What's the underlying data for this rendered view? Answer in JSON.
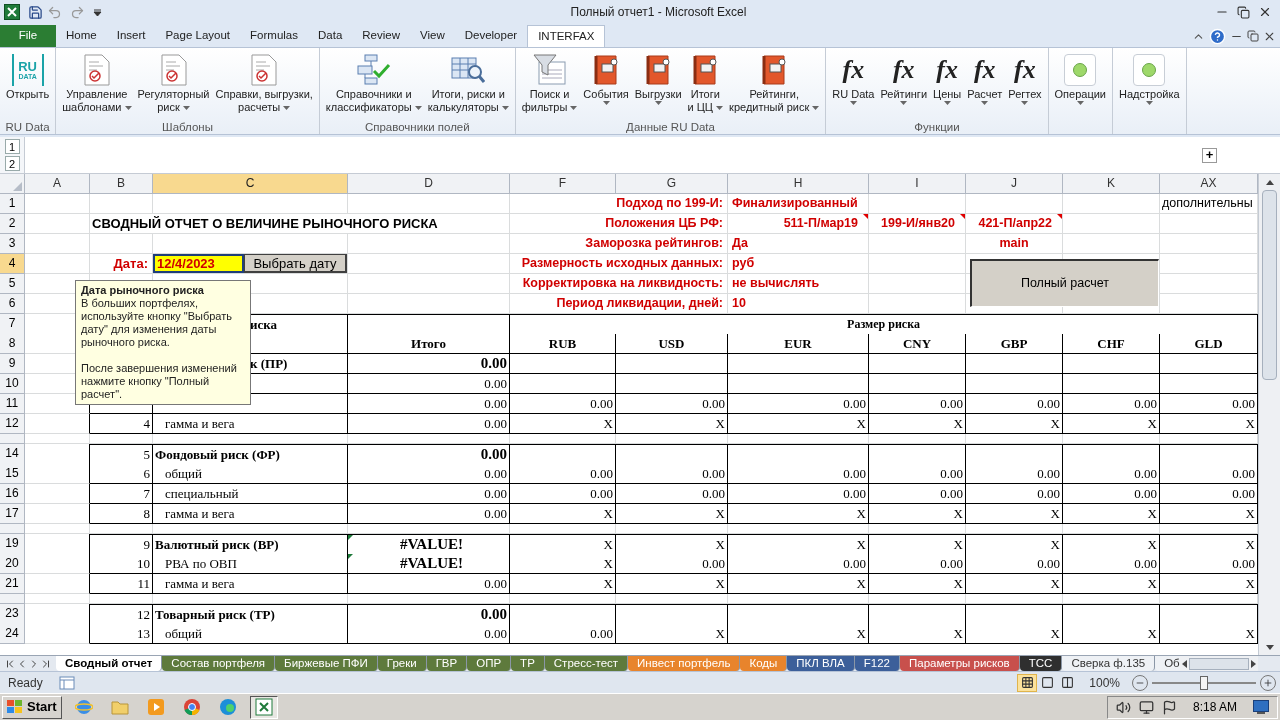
{
  "window": {
    "title": "Полный отчет1 - Microsoft Excel"
  },
  "ribbon_tabs": [
    {
      "label": "File",
      "kind": "file",
      "selected": false
    },
    {
      "label": "Home",
      "kind": "tab",
      "selected": false
    },
    {
      "label": "Insert",
      "kind": "tab",
      "selected": false
    },
    {
      "label": "Page Layout",
      "kind": "tab",
      "selected": false
    },
    {
      "label": "Formulas",
      "kind": "tab",
      "selected": false
    },
    {
      "label": "Data",
      "kind": "tab",
      "selected": false
    },
    {
      "label": "Review",
      "kind": "tab",
      "selected": false
    },
    {
      "label": "View",
      "kind": "tab",
      "selected": false
    },
    {
      "label": "Developer",
      "kind": "tab",
      "selected": false
    },
    {
      "label": "INTERFAX",
      "kind": "tab",
      "selected": true
    }
  ],
  "ribbon_groups": [
    {
      "label": "RU Data",
      "buttons": [
        {
          "kind": "ru",
          "glyph": [
            "RU",
            "DATA"
          ],
          "lines": [
            "Открыть"
          ],
          "dropdown": false
        }
      ]
    },
    {
      "label": "Шаблоны",
      "buttons": [
        {
          "kind": "doc",
          "lines": [
            "Управление",
            "шаблонами"
          ],
          "dropdown": true
        },
        {
          "kind": "doc",
          "lines": [
            "Регуляторный",
            "риск"
          ],
          "dropdown": true
        },
        {
          "kind": "doc",
          "lines": [
            "Справки, выгрузки,",
            "расчеты"
          ],
          "dropdown": true
        }
      ]
    },
    {
      "label": "Справочники полей",
      "buttons": [
        {
          "kind": "flow",
          "lines": [
            "Справочники и",
            "классификаторы"
          ],
          "dropdown": true
        },
        {
          "kind": "table",
          "lines": [
            "Итоги, риски и",
            "калькуляторы"
          ],
          "dropdown": true
        }
      ]
    },
    {
      "label": "Данные RU Data",
      "buttons": [
        {
          "kind": "funnel",
          "lines": [
            "Поиск и",
            "фильтры"
          ],
          "dropdown": true
        },
        {
          "kind": "book",
          "lines": [
            "События"
          ],
          "dropdown": true
        },
        {
          "kind": "book",
          "lines": [
            "Выгрузки"
          ],
          "dropdown": true
        },
        {
          "kind": "book",
          "lines": [
            "Итоги",
            "и ЦЦ"
          ],
          "dropdown": true
        },
        {
          "kind": "book",
          "lines": [
            "Рейтинги,",
            "кредитный риск"
          ],
          "dropdown": true
        }
      ]
    },
    {
      "label": "Функции",
      "buttons": [
        {
          "kind": "fx",
          "glyph": [
            "fx"
          ],
          "lines": [
            "RU Data"
          ],
          "dropdown": true
        },
        {
          "kind": "fx",
          "glyph": [
            "fx"
          ],
          "lines": [
            "Рейтинги"
          ],
          "dropdown": true
        },
        {
          "kind": "fx",
          "glyph": [
            "fx"
          ],
          "lines": [
            "Цены"
          ],
          "dropdown": true
        },
        {
          "kind": "fx",
          "glyph": [
            "fx"
          ],
          "lines": [
            "Расчет"
          ],
          "dropdown": true
        },
        {
          "kind": "fx",
          "glyph": [
            "fx"
          ],
          "lines": [
            "Регтех"
          ],
          "dropdown": true
        }
      ]
    },
    {
      "buttons": [
        {
          "kind": "light",
          "lines": [
            "Операции"
          ],
          "dropdown": true
        }
      ]
    },
    {
      "buttons": [
        {
          "kind": "light",
          "lines": [
            "Надстройка"
          ],
          "dropdown": true
        }
      ]
    }
  ],
  "sheet": {
    "outline_levels": [
      "1",
      "2"
    ],
    "expand_button": "+",
    "columns": [
      {
        "label": "A",
        "selected": false
      },
      {
        "label": "B",
        "selected": false
      },
      {
        "label": "C",
        "selected": true
      },
      {
        "label": "D",
        "selected": false
      },
      {
        "label": "F",
        "selected": false
      },
      {
        "label": "G",
        "selected": false
      },
      {
        "label": "H",
        "selected": false
      },
      {
        "label": "I",
        "selected": false
      },
      {
        "label": "J",
        "selected": false
      },
      {
        "label": "K",
        "selected": false
      },
      {
        "label": "AX",
        "selected": false
      }
    ],
    "rows": [
      {
        "kind": "row",
        "header": "1",
        "selected": false,
        "bordered": false,
        "cells": [
          null,
          null,
          null,
          null,
          {
            "kind": "label",
            "text": "Подход по 199-И:"
          },
          {
            "kind": "value",
            "text": "Финализированный"
          },
          null,
          null,
          null,
          {
            "kind": "note",
            "text": "дополнительны"
          }
        ]
      },
      {
        "kind": "row",
        "header": "2",
        "selected": false,
        "bordered": false,
        "cells": [
          null,
          {
            "kind": "title",
            "text": "СВОДНЫЙ ОТЧЕТ О ВЕЛИЧИНЕ РЫНОЧНОГО РИСКА"
          },
          {
            "kind": "label",
            "text": "Положения ЦБ РФ:"
          },
          {
            "kind": "ref",
            "text": "511-П/мар19"
          },
          {
            "kind": "ref",
            "text": "199-И/янв20"
          },
          {
            "kind": "ref",
            "text": "421-П/апр22"
          },
          null,
          null
        ]
      },
      {
        "kind": "row",
        "header": "3",
        "selected": false,
        "bordered": false,
        "cells": [
          null,
          null,
          null,
          null,
          {
            "kind": "label",
            "text": "Заморозка рейтингов:"
          },
          {
            "kind": "value",
            "text": "Да"
          },
          null,
          {
            "kind": "center",
            "text": "main"
          },
          null,
          null
        ]
      },
      {
        "kind": "row",
        "header": "4",
        "selected": true,
        "bordered": false,
        "cells": [
          null,
          {
            "kind": "caption",
            "text": "Дата:"
          },
          {
            "kind": "date",
            "text": "12/4/2023",
            "button": "Выбрать дату"
          },
          null,
          {
            "kind": "label",
            "text": "Размерность исходных данных:"
          },
          {
            "kind": "value",
            "text": "руб"
          },
          null,
          null,
          null,
          null
        ]
      },
      {
        "kind": "row",
        "header": "5",
        "selected": false,
        "bordered": false,
        "cells": [
          null,
          null,
          null,
          null,
          {
            "kind": "label",
            "text": "Корректировка на ликвидность:"
          },
          {
            "kind": "value",
            "text": "не вычислять"
          },
          null,
          null,
          null,
          null
        ]
      },
      {
        "kind": "row",
        "header": "6",
        "selected": false,
        "bordered": false,
        "cells": [
          null,
          null,
          null,
          null,
          {
            "kind": "label",
            "text": "Период ликвидации, дней:"
          },
          {
            "kind": "value",
            "text": "10"
          },
          null,
          null,
          null,
          null
        ]
      },
      {
        "kind": "row",
        "header": "7",
        "selected": false,
        "bordered": true,
        "cells": [
          null,
          null,
          {
            "kind": "covered",
            "text": "иска"
          },
          null,
          {
            "kind": "wide",
            "text": "Размер риска"
          }
        ]
      },
      {
        "kind": "row",
        "header": "8",
        "selected": false,
        "bordered": true,
        "cells": [
          null,
          null,
          null,
          {
            "kind": "head",
            "text": "Итого"
          },
          {
            "kind": "head",
            "text": "RUB"
          },
          {
            "kind": "head",
            "text": "USD"
          },
          {
            "kind": "head",
            "text": "EUR"
          },
          {
            "kind": "head",
            "text": "CNY"
          },
          {
            "kind": "head",
            "text": "GBP"
          },
          {
            "kind": "head",
            "text": "CHF"
          },
          {
            "kind": "head",
            "text": "GLD"
          }
        ]
      },
      {
        "kind": "row",
        "header": "9",
        "selected": false,
        "bordered": true,
        "cells": [
          null,
          null,
          {
            "kind": "covered",
            "text": "к (ПР)"
          },
          {
            "kind": "total",
            "text": "0.00"
          },
          null,
          null,
          null,
          null,
          null,
          null,
          null
        ]
      },
      {
        "kind": "row",
        "header": "10",
        "selected": false,
        "bordered": true,
        "cells": [
          null,
          null,
          null,
          {
            "kind": "num",
            "text": "0.00"
          },
          null,
          null,
          null,
          null,
          null,
          null,
          null
        ]
      },
      {
        "kind": "row",
        "header": "11",
        "selected": false,
        "bordered": true,
        "cells": [
          null,
          null,
          null,
          {
            "kind": "num",
            "text": "0.00"
          },
          {
            "kind": "num",
            "text": "0.00"
          },
          {
            "kind": "num",
            "text": "0.00"
          },
          {
            "kind": "num",
            "text": "0.00"
          },
          {
            "kind": "num",
            "text": "0.00"
          },
          {
            "kind": "num",
            "text": "0.00"
          },
          {
            "kind": "num",
            "text": "0.00"
          },
          {
            "kind": "num",
            "text": "0.00"
          }
        ]
      },
      {
        "kind": "row",
        "header": "12",
        "selected": false,
        "bordered": true,
        "cells": [
          null,
          {
            "kind": "index",
            "text": "4"
          },
          {
            "kind": "name",
            "text": "гамма и вега"
          },
          {
            "kind": "num",
            "text": "0.00"
          },
          {
            "kind": "num",
            "text": "X"
          },
          {
            "kind": "num",
            "text": "X"
          },
          {
            "kind": "num",
            "text": "X"
          },
          {
            "kind": "num",
            "text": "X"
          },
          {
            "kind": "num",
            "text": "X"
          },
          {
            "kind": "num",
            "text": "X"
          },
          {
            "kind": "num",
            "text": "X"
          }
        ]
      },
      {
        "kind": "spacer"
      },
      {
        "kind": "row",
        "header": "14",
        "selected": false,
        "bordered": true,
        "cells": [
          null,
          {
            "kind": "index",
            "text": "5"
          },
          {
            "kind": "group",
            "text": "Фондовый риск (ФР)"
          },
          {
            "kind": "total",
            "text": "0.00"
          },
          null,
          null,
          null,
          null,
          null,
          null,
          null
        ]
      },
      {
        "kind": "row",
        "header": "15",
        "selected": false,
        "bordered": true,
        "cells": [
          null,
          {
            "kind": "index",
            "text": "6"
          },
          {
            "kind": "name",
            "text": "общий"
          },
          {
            "kind": "num",
            "text": "0.00"
          },
          {
            "kind": "num",
            "text": "0.00"
          },
          {
            "kind": "num",
            "text": "0.00"
          },
          {
            "kind": "num",
            "text": "0.00"
          },
          {
            "kind": "num",
            "text": "0.00"
          },
          {
            "kind": "num",
            "text": "0.00"
          },
          {
            "kind": "num",
            "text": "0.00"
          },
          {
            "kind": "num",
            "text": "0.00"
          }
        ]
      },
      {
        "kind": "row",
        "header": "16",
        "selected": false,
        "bordered": true,
        "cells": [
          null,
          {
            "kind": "index",
            "text": "7"
          },
          {
            "kind": "name",
            "text": "специальный"
          },
          {
            "kind": "num",
            "text": "0.00"
          },
          {
            "kind": "num",
            "text": "0.00"
          },
          {
            "kind": "num",
            "text": "0.00"
          },
          {
            "kind": "num",
            "text": "0.00"
          },
          {
            "kind": "num",
            "text": "0.00"
          },
          {
            "kind": "num",
            "text": "0.00"
          },
          {
            "kind": "num",
            "text": "0.00"
          },
          {
            "kind": "num",
            "text": "0.00"
          }
        ]
      },
      {
        "kind": "row",
        "header": "17",
        "selected": false,
        "bordered": true,
        "cells": [
          null,
          {
            "kind": "index",
            "text": "8"
          },
          {
            "kind": "name",
            "text": "гамма и вега"
          },
          {
            "kind": "num",
            "text": "0.00"
          },
          {
            "kind": "num",
            "text": "X"
          },
          {
            "kind": "num",
            "text": "X"
          },
          {
            "kind": "num",
            "text": "X"
          },
          {
            "kind": "num",
            "text": "X"
          },
          {
            "kind": "num",
            "text": "X"
          },
          {
            "kind": "num",
            "text": "X"
          },
          {
            "kind": "num",
            "text": "X"
          }
        ]
      },
      {
        "kind": "spacer"
      },
      {
        "kind": "row",
        "header": "19",
        "selected": false,
        "bordered": true,
        "cells": [
          null,
          {
            "kind": "index",
            "text": "9"
          },
          {
            "kind": "group",
            "text": "Валютный риск (ВР)"
          },
          {
            "kind": "error",
            "text": "#VALUE!"
          },
          {
            "kind": "num",
            "text": "X"
          },
          {
            "kind": "num",
            "text": "X"
          },
          {
            "kind": "num",
            "text": "X"
          },
          {
            "kind": "num",
            "text": "X"
          },
          {
            "kind": "num",
            "text": "X"
          },
          {
            "kind": "num",
            "text": "X"
          },
          {
            "kind": "num",
            "text": "X"
          }
        ]
      },
      {
        "kind": "row",
        "header": "20",
        "selected": false,
        "bordered": true,
        "cells": [
          null,
          {
            "kind": "index",
            "text": "10"
          },
          {
            "kind": "name",
            "text": "РВА по ОВП"
          },
          {
            "kind": "error",
            "text": "#VALUE!"
          },
          {
            "kind": "num",
            "text": "X"
          },
          {
            "kind": "num",
            "text": "0.00"
          },
          {
            "kind": "num",
            "text": "0.00"
          },
          {
            "kind": "num",
            "text": "0.00"
          },
          {
            "kind": "num",
            "text": "0.00"
          },
          {
            "kind": "num",
            "text": "0.00"
          },
          {
            "kind": "num",
            "text": "0.00"
          }
        ]
      },
      {
        "kind": "row",
        "header": "21",
        "selected": false,
        "bordered": true,
        "cells": [
          null,
          {
            "kind": "index",
            "text": "11"
          },
          {
            "kind": "name",
            "text": "гамма и вега"
          },
          {
            "kind": "num",
            "text": "0.00"
          },
          {
            "kind": "num",
            "text": "X"
          },
          {
            "kind": "num",
            "text": "X"
          },
          {
            "kind": "num",
            "text": "X"
          },
          {
            "kind": "num",
            "text": "X"
          },
          {
            "kind": "num",
            "text": "X"
          },
          {
            "kind": "num",
            "text": "X"
          },
          {
            "kind": "num",
            "text": "X"
          }
        ]
      },
      {
        "kind": "spacer"
      },
      {
        "kind": "row",
        "header": "23",
        "selected": false,
        "bordered": true,
        "cells": [
          null,
          {
            "kind": "index",
            "text": "12"
          },
          {
            "kind": "group",
            "text": "Товарный риск (ТР)"
          },
          {
            "kind": "total",
            "text": "0.00"
          },
          null,
          null,
          null,
          null,
          null,
          null,
          null
        ]
      },
      {
        "kind": "row",
        "header": "24",
        "selected": false,
        "bordered": true,
        "cells": [
          null,
          {
            "kind": "index",
            "text": "13"
          },
          {
            "kind": "name",
            "text": "общий"
          },
          {
            "kind": "num",
            "text": "0.00"
          },
          {
            "kind": "num",
            "text": "0.00"
          },
          {
            "kind": "num",
            "text": "X"
          },
          {
            "kind": "num",
            "text": "X"
          },
          {
            "kind": "num",
            "text": "X"
          },
          {
            "kind": "num",
            "text": "X"
          },
          {
            "kind": "num",
            "text": "X"
          },
          {
            "kind": "num",
            "text": "X"
          }
        ]
      }
    ],
    "comment": {
      "title": "Дата рыночного риска",
      "paragraphs": [
        "В больших портфелях, используйте кнопку \"Выбрать дату\" для изменения даты рыночного риска.",
        "После завершения изменений нажмите кнопку \"Полный расчет\"."
      ]
    },
    "floating_button": {
      "label": "Полный расчет"
    }
  },
  "sheet_tabs": [
    {
      "label": "Сводный отчет",
      "selected": true
    },
    {
      "label": "Состав портфеля",
      "selected": false,
      "color": "#5e7a3c"
    },
    {
      "label": "Биржевые ПФИ",
      "selected": false,
      "color": "#5e7a3c"
    },
    {
      "label": "Греки",
      "selected": false,
      "color": "#5e7a3c"
    },
    {
      "label": "ГВР",
      "selected": false,
      "color": "#5e7a3c"
    },
    {
      "label": "ОПР",
      "selected": false,
      "color": "#5e7a3c"
    },
    {
      "label": "ТР",
      "selected": false,
      "color": "#5e7a3c"
    },
    {
      "label": "Стресс-тест",
      "selected": false,
      "color": "#5e7a3c"
    },
    {
      "label": "Инвест портфель",
      "selected": false,
      "color": "#e8842c"
    },
    {
      "label": "Коды",
      "selected": false,
      "color": "#e8842c"
    },
    {
      "label": "ПКЛ ВЛА",
      "selected": false,
      "color": "#3c5f9a"
    },
    {
      "label": "F122",
      "selected": false,
      "color": "#3c5f9a"
    },
    {
      "label": "Параметры рисков",
      "selected": false,
      "color": "#c8504c"
    },
    {
      "label": "ТСС",
      "selected": false,
      "color": "#2f2f2f"
    },
    {
      "label": "Сверка ф.135",
      "selected": false
    },
    {
      "label": "Об",
      "selected": false
    }
  ],
  "status_bar": {
    "text": "Ready",
    "views": [
      {
        "kind": "normal",
        "selected": true
      },
      {
        "kind": "layout",
        "selected": false
      },
      {
        "kind": "pagebreak",
        "selected": false
      }
    ],
    "zoom": {
      "reading": "100%",
      "level": 0.5
    }
  },
  "taskbar": {
    "start": "Start",
    "apps": [
      {
        "kind": "ie",
        "selected": false
      },
      {
        "kind": "folder",
        "selected": false
      },
      {
        "kind": "media",
        "selected": false
      },
      {
        "kind": "chrome",
        "selected": false
      },
      {
        "kind": "edge",
        "selected": false
      },
      {
        "kind": "excel",
        "selected": true
      }
    ],
    "clock": "8:18 AM"
  }
}
